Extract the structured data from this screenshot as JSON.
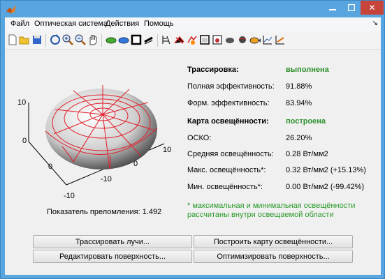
{
  "window": {
    "title": "",
    "min_icon": "minimize-icon",
    "max_icon": "maximize-icon",
    "close_label": "✕"
  },
  "menu": {
    "items": [
      "Файл",
      "Оптическая система",
      "Действия",
      "Помощь"
    ],
    "overflow": "↘"
  },
  "toolbar": {
    "icons": [
      "new-file-icon",
      "open-folder-icon",
      "save-icon",
      "rotate-3d-icon",
      "zoom-in-icon",
      "zoom-out-icon",
      "pan-hand-icon",
      "green-lens-icon",
      "blue-lens-icon",
      "black-square-icon",
      "beam-icon",
      "ray-grid-icon",
      "ray-trace-icon",
      "source-icon",
      "window-icon",
      "image-icon",
      "ellipsoid-icon",
      "sphere-icon",
      "fish-icon",
      "chart-icon",
      "chart-arrow-icon"
    ]
  },
  "plot": {
    "z_ticks": [
      "10",
      "0"
    ],
    "x_ticks": [
      "0",
      "10"
    ],
    "y_ticks": [
      "-10",
      "0",
      "10"
    ],
    "x_axis_extra_tick": "-10"
  },
  "refraction": {
    "label": "Показатель преломления:",
    "value": "1.492"
  },
  "results": {
    "trace_title": "Трассировка:",
    "trace_status": "выполнена",
    "full_eff_label": "Полная эффективность:",
    "full_eff_value": "91.88%",
    "form_eff_label": "Форм. эффективность:",
    "form_eff_value": "83.94%",
    "map_title": "Карта освещённости:",
    "map_status": "построена",
    "rms_label": "ОСКО:",
    "rms_value": "26.20%",
    "avg_label": "Средняя освещённость:",
    "avg_value": "0.28 Вт/мм2",
    "max_label": "Макс. освещённость*:",
    "max_value": "0.32 Вт/мм2 (+15.13%)",
    "min_label": "Мин. освещённость*:",
    "min_value": "0.00 Вт/мм2 (-99.42%)",
    "note_line1": "* максимальная и минимальная освещённости",
    "note_line2": "рассчитаны внутри освещаемой области"
  },
  "buttons": {
    "trace": "Трассировать лучи...",
    "build_map": "Построить карту освещённости...",
    "edit_surface": "Редактировать поверхность...",
    "optimize_surface": "Оптимизировать поверхность..."
  },
  "colors": {
    "titlebar": "#58a5df",
    "close": "#c7443a",
    "status_green": "#2a8f2a",
    "mesh_red": "#e0202a"
  }
}
